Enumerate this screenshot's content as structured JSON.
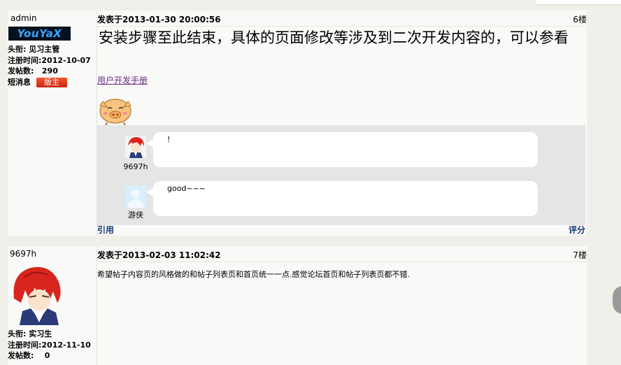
{
  "post1": {
    "username": "admin",
    "logo_text": "YouYaX",
    "title_label": "头衔: 见习主管",
    "regdate_label": "注册时间:2012-10-07",
    "posts_label": "发帖数:",
    "posts_count": "290",
    "msg_label": "短消息",
    "badge": "版主",
    "meta": "发表于2013-01-30 20:00:56",
    "floor": "6楼",
    "content": "安装步骤至此结束，具体的页面修改等涉及到二次开发内容的，可以参看",
    "link": "用户开发手册",
    "comments": [
      {
        "user": "9697h",
        "text": "!"
      },
      {
        "user": "游侠",
        "text": "good~~~"
      }
    ],
    "quote": "引用",
    "rate": "评分"
  },
  "post2": {
    "username": "9697h",
    "title_label": "头衔: 实习生",
    "regdate_label": "注册时间:2012-11-10",
    "posts_label": "发帖数:",
    "posts_count": "0",
    "meta": "发表于2013-02-03 11:02:42",
    "floor": "7楼",
    "content": "希望帖子内容页的风格做的和帖子列表页和首页统一一点.感觉论坛首页和帖子列表页都不错."
  }
}
